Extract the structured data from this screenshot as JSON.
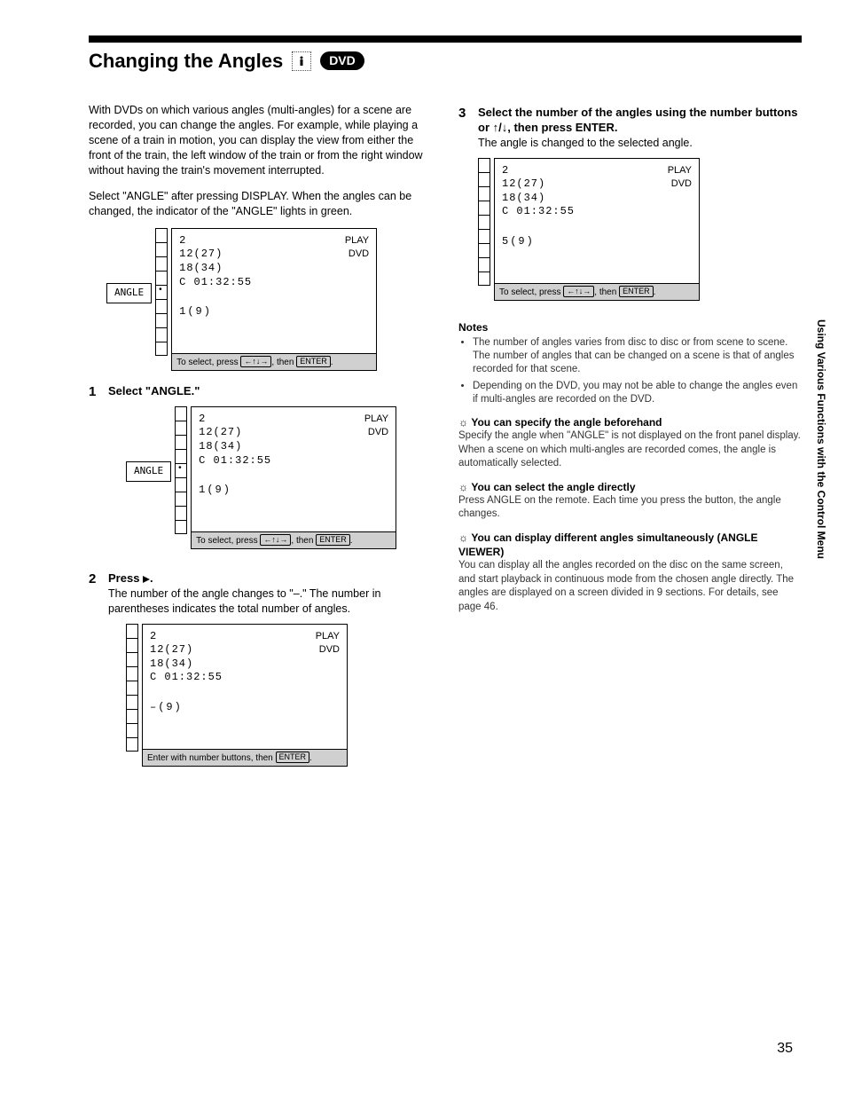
{
  "header": {
    "title": "Changing the Angles",
    "badge": "DVD"
  },
  "sideTab": "Using Various Functions with the Control Menu",
  "pageNumber": "35",
  "left": {
    "intro1": "With DVDs on which various angles (multi-angles) for a scene are recorded, you can change the angles. For example, while playing a scene of a train in motion, you can display the view from either the front of the train, the left window of the train or from the right window without having the train's movement interrupted.",
    "intro2": "Select \"ANGLE\" after pressing DISPLAY. When the angles can be changed, the indicator of the \"ANGLE\" lights in green.",
    "step1": {
      "num": "1",
      "title": "Select \"ANGLE.\""
    },
    "step2": {
      "num": "2",
      "title": "Press ➔.",
      "desc": "The number of the angle changes to \"–.\" The number in parentheses indicates the total number of angles."
    }
  },
  "right": {
    "step3": {
      "num": "3",
      "title": "Select the number of the angles using the number buttons or ↑/↓, then press ENTER.",
      "desc": "The angle is changed to the selected angle."
    },
    "notesHead": "Notes",
    "notes": [
      "The number of angles varies from disc to disc or from scene to scene. The number of angles that can be changed on a scene is that of angles recorded for that scene.",
      "Depending on the DVD, you may not be able to change the angles even if multi-angles are recorded on the DVD."
    ],
    "tip1": {
      "head": "You can specify the angle beforehand",
      "body": "Specify the angle when \"ANGLE\" is not displayed on the front panel display. When a scene on which multi-angles are recorded comes, the angle is automatically selected."
    },
    "tip2": {
      "head": "You can select the angle directly",
      "body": "Press ANGLE on the remote. Each time you press the button, the angle changes."
    },
    "tip3": {
      "head": "You can display different angles simultaneously (ANGLE VIEWER)",
      "body": "You can display all the angles recorded on the disc on the same screen, and start playback in continuous mode from the chosen angle directly. The angles are displayed on a screen divided in 9 sections. For details, see page 46."
    }
  },
  "osd": {
    "line1": "2",
    "line2": "12(27)",
    "line3": "18(34)",
    "line4": "C  01:32:55",
    "status1": "PLAY",
    "status2": "DVD",
    "angle1": "1(9)",
    "angleDash": "–(9)",
    "angle5": "5(9)",
    "footSelect_pre": "To select, press ",
    "footSelect_post": ", then ",
    "footEnter_pre": "Enter with number buttons, then ",
    "enterKey": "ENTER",
    "arrowKeys": "←↑↓→",
    "angleLabel": "ANGLE"
  }
}
